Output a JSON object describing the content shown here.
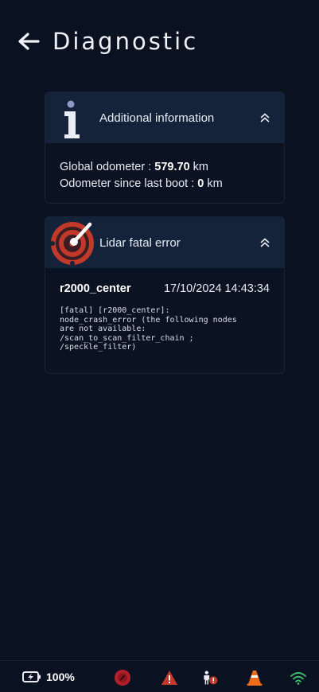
{
  "header": {
    "title": "Diagnostic"
  },
  "info_card": {
    "title": "Additional information",
    "global_odometer_label": "Global odometer : ",
    "global_odometer_value": "579.70",
    "global_odometer_unit": " km",
    "boot_odometer_label": "Odometer since last boot : ",
    "boot_odometer_value": "0",
    "boot_odometer_unit": " km"
  },
  "lidar_card": {
    "title": "Lidar fatal error",
    "source": "r2000_center",
    "timestamp": "17/10/2024 14:43:34",
    "message": "[fatal] [r2000_center]:\nnode_crash_error (the following nodes\nare not available:\n/scan_to_scan_filter_chain ;\n/speckle_filter)"
  },
  "status_bar": {
    "battery_percent": "100%",
    "icons": [
      "battery-charging-icon",
      "emergency-stop-icon",
      "warning-icon",
      "person-alert-icon",
      "traffic-cone-icon",
      "wifi-icon"
    ]
  },
  "colors": {
    "background": "#0a1120",
    "card_header": "#14223a",
    "accent_red": "#c0392b",
    "warning_orange": "#ef6c1a",
    "wifi_green": "#3fbf6b",
    "info_icon": "#e9edf5"
  }
}
